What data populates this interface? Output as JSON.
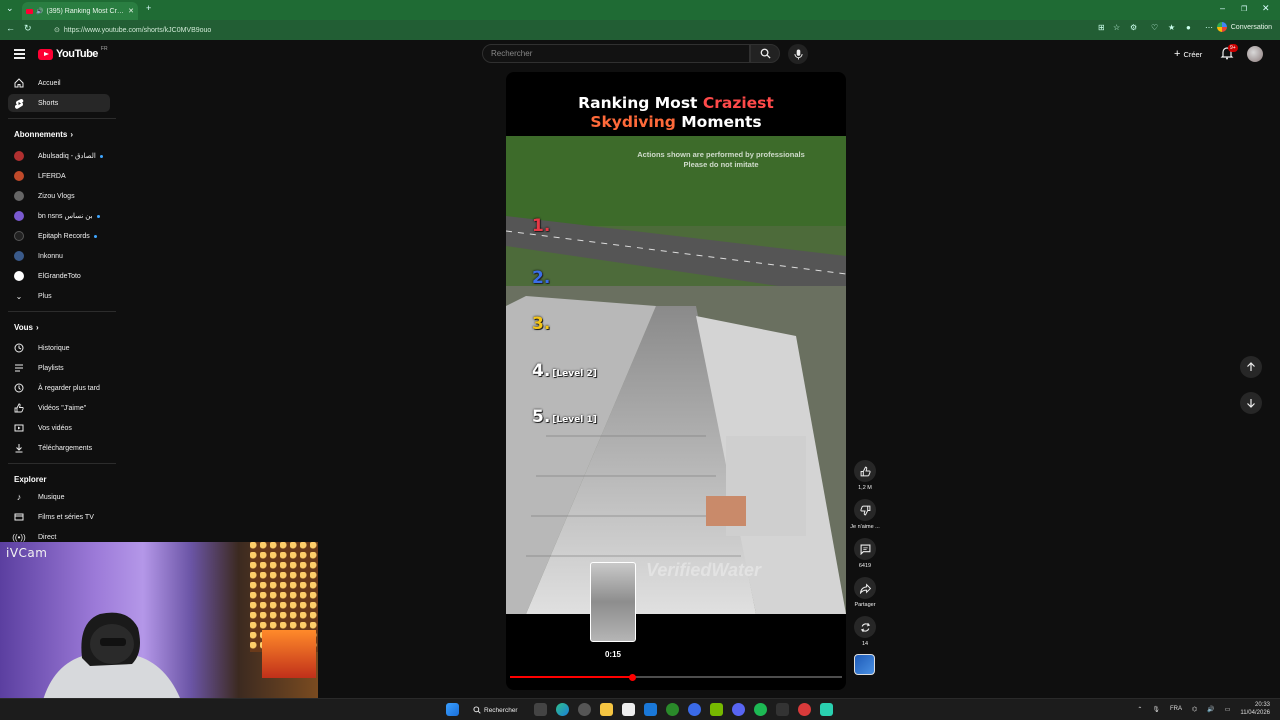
{
  "browser": {
    "tab_title": "(395) Ranking Most Craziest S",
    "url": "https://www.youtube.com/shorts/kJC0MVB9ouo",
    "conversation_label": "Conversation"
  },
  "header": {
    "logo_text": "YouTube",
    "logo_region": "FR",
    "search_placeholder": "Rechercher",
    "create_label": "Créer",
    "notification_count": "9+"
  },
  "sidebar": {
    "main": [
      {
        "label": "Accueil",
        "icon": "home-icon"
      },
      {
        "label": "Shorts",
        "icon": "shorts-icon",
        "active": true
      }
    ],
    "subscriptions_heading": "Abonnements",
    "subscriptions": [
      {
        "label": "Abulsadiq - الصادق",
        "live": true,
        "color": "#b03030"
      },
      {
        "label": "LFERDA",
        "live": false,
        "color": "#c04a2a"
      },
      {
        "label": "Zizou Vlogs",
        "live": false,
        "color": "#666666"
      },
      {
        "label": "bn nsns بن نساس",
        "live": true,
        "color": "#7a5ad0"
      },
      {
        "label": "Epitaph Records",
        "live": true,
        "color": "#222222"
      },
      {
        "label": "Inkonnu",
        "live": false,
        "color": "#3a5a8a"
      },
      {
        "label": "ElGrandeToto",
        "live": false,
        "color": "#ffffff"
      }
    ],
    "more_label": "Plus",
    "you_heading": "Vous",
    "you_items": [
      {
        "label": "Historique",
        "icon": "history-icon"
      },
      {
        "label": "Playlists",
        "icon": "playlist-icon"
      },
      {
        "label": "À regarder plus tard",
        "icon": "watch-later-icon"
      },
      {
        "label": "Vidéos \"J'aime\"",
        "icon": "liked-videos-icon"
      },
      {
        "label": "Vos vidéos",
        "icon": "your-videos-icon"
      },
      {
        "label": "Téléchargements",
        "icon": "downloads-icon"
      }
    ],
    "explore_heading": "Explorer",
    "explore_items": [
      {
        "label": "Musique",
        "icon": "music-icon"
      },
      {
        "label": "Films et séries TV",
        "icon": "movies-icon"
      },
      {
        "label": "Direct",
        "icon": "live-icon"
      }
    ]
  },
  "webcam": {
    "label": "iVCam"
  },
  "short": {
    "title_white_1": "Ranking Most ",
    "title_red_1": "Craziest",
    "title_red_2": "Skydiving",
    "title_white_2": " Moments",
    "disclaimer_line1": "Actions shown are performed by professionals",
    "disclaimer_line2": "Please do not imitate",
    "ranks": [
      {
        "num": "1.",
        "level": "",
        "color": "#e63946"
      },
      {
        "num": "2.",
        "level": "",
        "color": "#3a6ee8"
      },
      {
        "num": "3.",
        "level": "",
        "color": "#f5c518"
      },
      {
        "num": "4.",
        "level": "[Level 2]",
        "color": "#ffffff"
      },
      {
        "num": "5.",
        "level": "[Level 1]",
        "color": "#ffffff"
      }
    ],
    "watermark": "VerifiedWater",
    "preview_time": "0:15",
    "progress": 0.37
  },
  "actions": {
    "likes": "1,2 M",
    "dislike_label": "Je n'aime ...",
    "comments": "6419",
    "share_label": "Partager",
    "remix_count": "14"
  },
  "taskbar": {
    "search_label": "Rechercher",
    "lang": "FRA",
    "time": "20:33",
    "date": "11/04/2026"
  }
}
